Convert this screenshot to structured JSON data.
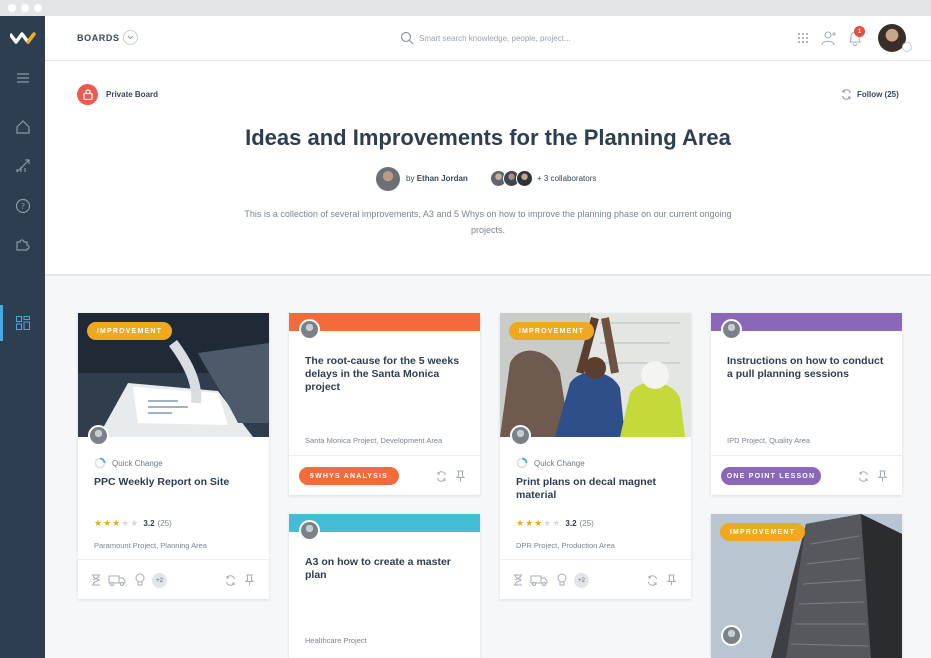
{
  "topbar": {
    "section_label": "BOARDS",
    "search_placeholder": "Smart search knowledge, people, project...",
    "notification_count": "1"
  },
  "icons": {
    "sidebar": [
      "menu-icon",
      "home-icon",
      "analytics-icon",
      "help-icon",
      "puzzle-icon",
      "boards-icon"
    ],
    "topbar": [
      "search-icon",
      "apps-grid-icon",
      "add-user-icon",
      "bell-icon"
    ]
  },
  "board": {
    "privacy_label": "Private Board",
    "follow_label": "Follow (25)",
    "title": "Ideas and Improvements for the Planning Area",
    "by_prefix": "by",
    "author": "Ethan Jordan",
    "collaborators_label": "+ 3 collaborators",
    "description": "This is a collection of several improvements, A3 and 5 Whys on how to improve the planning phase on our current ongoing projects."
  },
  "colors": {
    "sidebar_bg": "#2d3e50",
    "accent": "#4aa8e0",
    "improvement_tag": "#f0a81e",
    "five_whys": "#f26b3a",
    "one_point_lesson": "#8a67b8",
    "a3": "#45bcd6",
    "private_badge": "#ec5b4f",
    "notification": "#e74c3c"
  },
  "cards": [
    {
      "tag": "IMPROVEMENT",
      "status": "Quick Change",
      "title": "PPC Weekly Report on Site",
      "rating": "3.2",
      "rating_count": "(25)",
      "rating_value": 3,
      "project": "Paramount Project, Planning Area",
      "extra_count": "+2"
    },
    {
      "title": "The root-cause for the 5 weeks delays in the Santa Monica project",
      "project": "Santa Monica Project, Development Area",
      "tag": "5WHYS ANALYSIS"
    },
    {
      "title": "A3 on how to create a master plan",
      "project": "Healthcare Project"
    },
    {
      "tag": "IMPROVEMENT",
      "status": "Quick Change",
      "title": "Print plans on decal magnet material",
      "rating": "3.2",
      "rating_count": "(25)",
      "rating_value": 3,
      "project": "DPR Project, Production Area",
      "extra_count": "+2"
    },
    {
      "title": "Instructions on how to conduct a pull planning sessions",
      "project": "IPD Project, Quality Area",
      "tag": "ONE POINT LESSON"
    },
    {
      "tag": "IMPROVEMENT"
    }
  ]
}
